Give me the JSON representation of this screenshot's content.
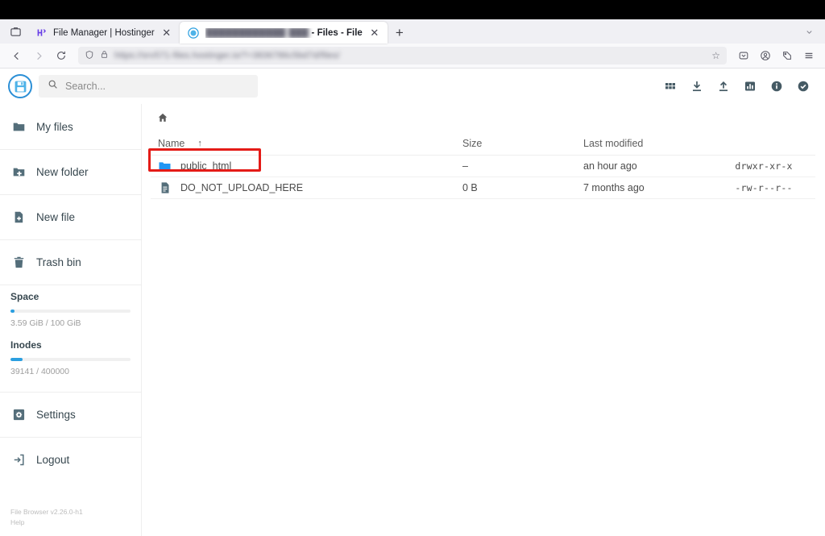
{
  "browser": {
    "tab_list_icon": "tab-list-icon",
    "tabs": [
      {
        "title": "File Manager | Hostinger",
        "favicon": "hostinger-favicon",
        "active": false,
        "blurred": false
      },
      {
        "title_prefix_blurred": "████████████ ███",
        "title_suffix": "- Files - File",
        "favicon": "filebrowser-favicon",
        "active": true,
        "blurred": true
      }
    ],
    "new_tab_label": "+",
    "list_all_tabs_icon": "chevron-down-icon",
    "nav": {
      "back_icon": "arrow-left-icon",
      "forward_icon": "arrow-right-icon",
      "reload_icon": "reload-icon",
      "shield_icon": "shield-icon",
      "lock_icon": "padlock-icon",
      "url_blurred": "https://srv571-files.hostinger.io/?=3836786c5bd7d/files/",
      "bookmark_icon": "star-icon",
      "right_icons": [
        "pocket-icon",
        "account-icon",
        "extensions-icon",
        "menu-icon"
      ]
    }
  },
  "app": {
    "logo_icon": "floppy-disk-logo",
    "search": {
      "icon": "search-icon",
      "placeholder": "Search..."
    },
    "header_actions": [
      {
        "name": "switch-view-icon",
        "label": "Switch view"
      },
      {
        "name": "download-icon",
        "label": "Download"
      },
      {
        "name": "upload-icon",
        "label": "Upload"
      },
      {
        "name": "info-stats-icon",
        "label": "Usage"
      },
      {
        "name": "info-icon",
        "label": "Info"
      },
      {
        "name": "select-multiple-icon",
        "label": "Select"
      }
    ],
    "sidebar": {
      "items": [
        {
          "label": "My files",
          "icon": "folder-icon"
        },
        {
          "label": "New folder",
          "icon": "folder-plus-icon"
        },
        {
          "label": "New file",
          "icon": "file-plus-icon"
        },
        {
          "label": "Trash bin",
          "icon": "trash-icon"
        }
      ],
      "meters": [
        {
          "label": "Space",
          "value": "3.59 GiB / 100 GiB",
          "percent": 3.6
        },
        {
          "label": "Inodes",
          "value": "39141 / 400000",
          "percent": 9.8
        }
      ],
      "bottom_items": [
        {
          "label": "Settings",
          "icon": "gear-icon"
        },
        {
          "label": "Logout",
          "icon": "logout-icon"
        }
      ],
      "footer": {
        "version": "File Browser v2.26.0-h1",
        "help": "Help"
      }
    },
    "breadcrumb": {
      "home_icon": "home-icon"
    },
    "table": {
      "columns": [
        "Name",
        "Size",
        "Last modified",
        ""
      ],
      "sort_column": "Name",
      "sort_arrow": "↑",
      "rows": [
        {
          "name": "public_html",
          "icon": "folder-icon-blue",
          "size": "–",
          "modified": "an hour ago",
          "permissions": "drwxr-xr-x",
          "highlighted": true
        },
        {
          "name": "DO_NOT_UPLOAD_HERE",
          "icon": "file-icon",
          "size": "0 B",
          "modified": "7 months ago",
          "permissions": "-rw-r--r--",
          "highlighted": false
        }
      ]
    }
  },
  "colors": {
    "accent_blue": "#2b9fe0",
    "folder_blue": "#2196f3",
    "highlight_red": "#e41b17",
    "sidebar_text": "#37474f"
  }
}
